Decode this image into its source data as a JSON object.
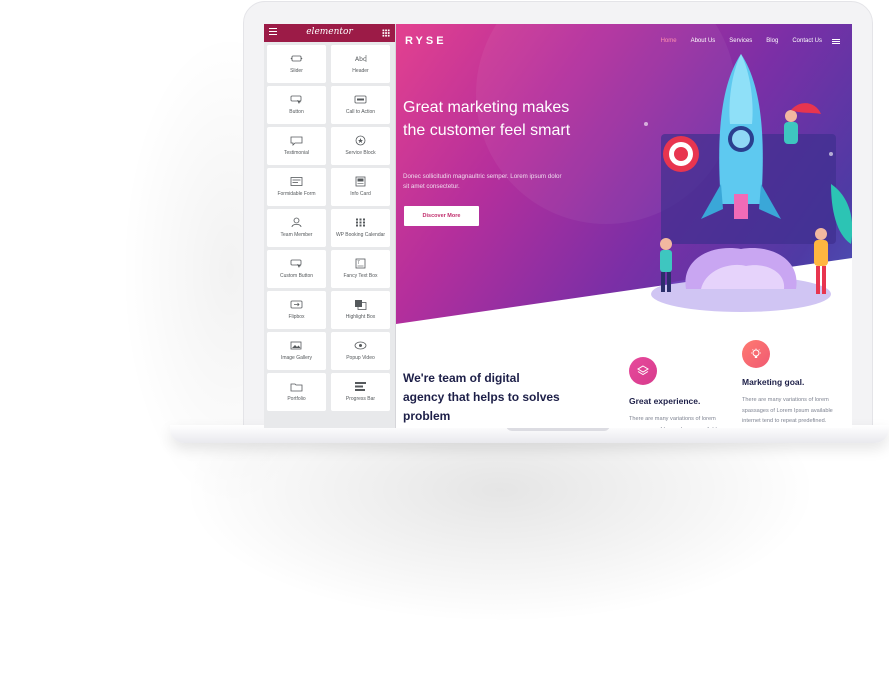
{
  "panel": {
    "logo": "elementor",
    "widgets": [
      {
        "label": "Slider",
        "icon": "slider-icon"
      },
      {
        "label": "Header",
        "icon": "header-icon"
      },
      {
        "label": "Button",
        "icon": "button-icon"
      },
      {
        "label": "Call to Action",
        "icon": "call-to-action-icon"
      },
      {
        "label": "Testimonial",
        "icon": "testimonial-icon"
      },
      {
        "label": "Service Block",
        "icon": "service-block-icon"
      },
      {
        "label": "Formidable Form",
        "icon": "form-icon"
      },
      {
        "label": "Info Card",
        "icon": "info-card-icon"
      },
      {
        "label": "Team Member",
        "icon": "team-member-icon"
      },
      {
        "label": "WP Booking Calendar",
        "icon": "calendar-icon"
      },
      {
        "label": "Custom Button",
        "icon": "custom-button-icon"
      },
      {
        "label": "Fancy Text Box",
        "icon": "fancy-text-box-icon"
      },
      {
        "label": "Flipbox",
        "icon": "flipbox-icon"
      },
      {
        "label": "Highlight Box",
        "icon": "highlight-box-icon"
      },
      {
        "label": "Image Gallery",
        "icon": "image-gallery-icon"
      },
      {
        "label": "Popup Video",
        "icon": "popup-video-icon"
      },
      {
        "label": "Portfolio",
        "icon": "portfolio-icon"
      },
      {
        "label": "Progress Bar",
        "icon": "progress-bar-icon"
      }
    ]
  },
  "site": {
    "brand": "RYSE",
    "nav": [
      "Home",
      "About Us",
      "Services",
      "Blog",
      "Contact Us"
    ],
    "active_nav": "Home",
    "hero": {
      "headline": "Great marketing makes the customer feel smart",
      "description": "Donec sollicitudin magnaultric semper. Lorem ipsum dolor sit amet consectetur.",
      "cta": "Discover More"
    },
    "about": {
      "heading": "We're team of digital agency that helps to solves problem"
    },
    "features": [
      {
        "title": "Great experience.",
        "text": "There are many variations of lorem spassages of Lorem Ipsum available",
        "icon": "layers-icon"
      },
      {
        "title": "Marketing goal.",
        "text": "There are many variations of lorem spassages of Lorem Ipsum available internet tend to repeat predefined.",
        "icon": "lightbulb-icon"
      }
    ]
  },
  "colors": {
    "panel_header": "#9c1b47",
    "hero_start": "#e3418f",
    "hero_end": "#4b56b8",
    "accent": "#c12d6c",
    "heading": "#1d1f48"
  }
}
